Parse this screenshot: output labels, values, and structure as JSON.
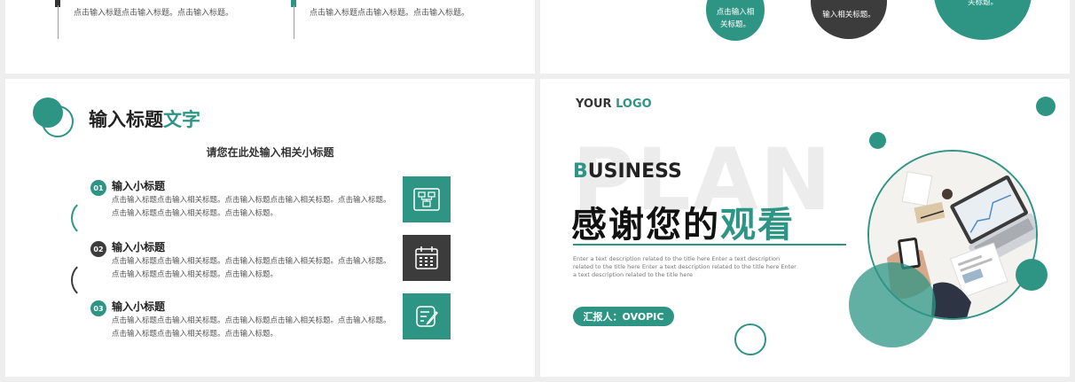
{
  "top_left": {
    "text_a": "点击输入标题点击输入标题。点击输入标题。",
    "text_b": "点击输入标题点击输入标题。点击输入标题。"
  },
  "top_right": {
    "circle1_text": "点击输入相关标题。",
    "circle2_text": "输入相关标题。",
    "circle3_text": "关标题。"
  },
  "bottom_left": {
    "title_main": "输入标题",
    "title_accent": "文字",
    "subtitle": "请您在此处输入相关小标题",
    "items": [
      {
        "num": "01",
        "title": "输入小标题",
        "body": "点击输入标题点击输入相关标题。点击输入标题点击输入相关标题。点击输入标题。点击输入标题点击输入相关标题。点击输入标题。",
        "icon": "flowchart-icon",
        "num_color": "#2e9584",
        "box_color": "#2e9584"
      },
      {
        "num": "02",
        "title": "输入小标题",
        "body": "点击输入标题点击输入相关标题。点击输入标题点击输入相关标题。点击输入标题。点击输入标题点击输入相关标题。点击输入标题。",
        "icon": "calendar-icon",
        "num_color": "#3c3c3c",
        "box_color": "#3c3c3c"
      },
      {
        "num": "03",
        "title": "输入小标题",
        "body": "点击输入标题点击输入相关标题。点击输入标题点击输入相关标题。点击输入标题。点击输入标题点击输入相关标题。点击输入标题。",
        "icon": "edit-document-icon",
        "num_color": "#2e9584",
        "box_color": "#2e9584"
      }
    ]
  },
  "bottom_right": {
    "logo_main": "YOUR ",
    "logo_accent": "LOGO",
    "bg_word": "PLAN",
    "business_first": "B",
    "business_rest": "USINESS",
    "thanks_main": "感谢您的",
    "thanks_accent": "观看",
    "description": "Enter a text description related to the title here Enter a text description related to the title here Enter a text description related to the title here Enter a text description related to the title here",
    "reporter": "汇报人：OVOPIC"
  },
  "colors": {
    "accent": "#2e9584",
    "dark": "#3c3c3c"
  }
}
